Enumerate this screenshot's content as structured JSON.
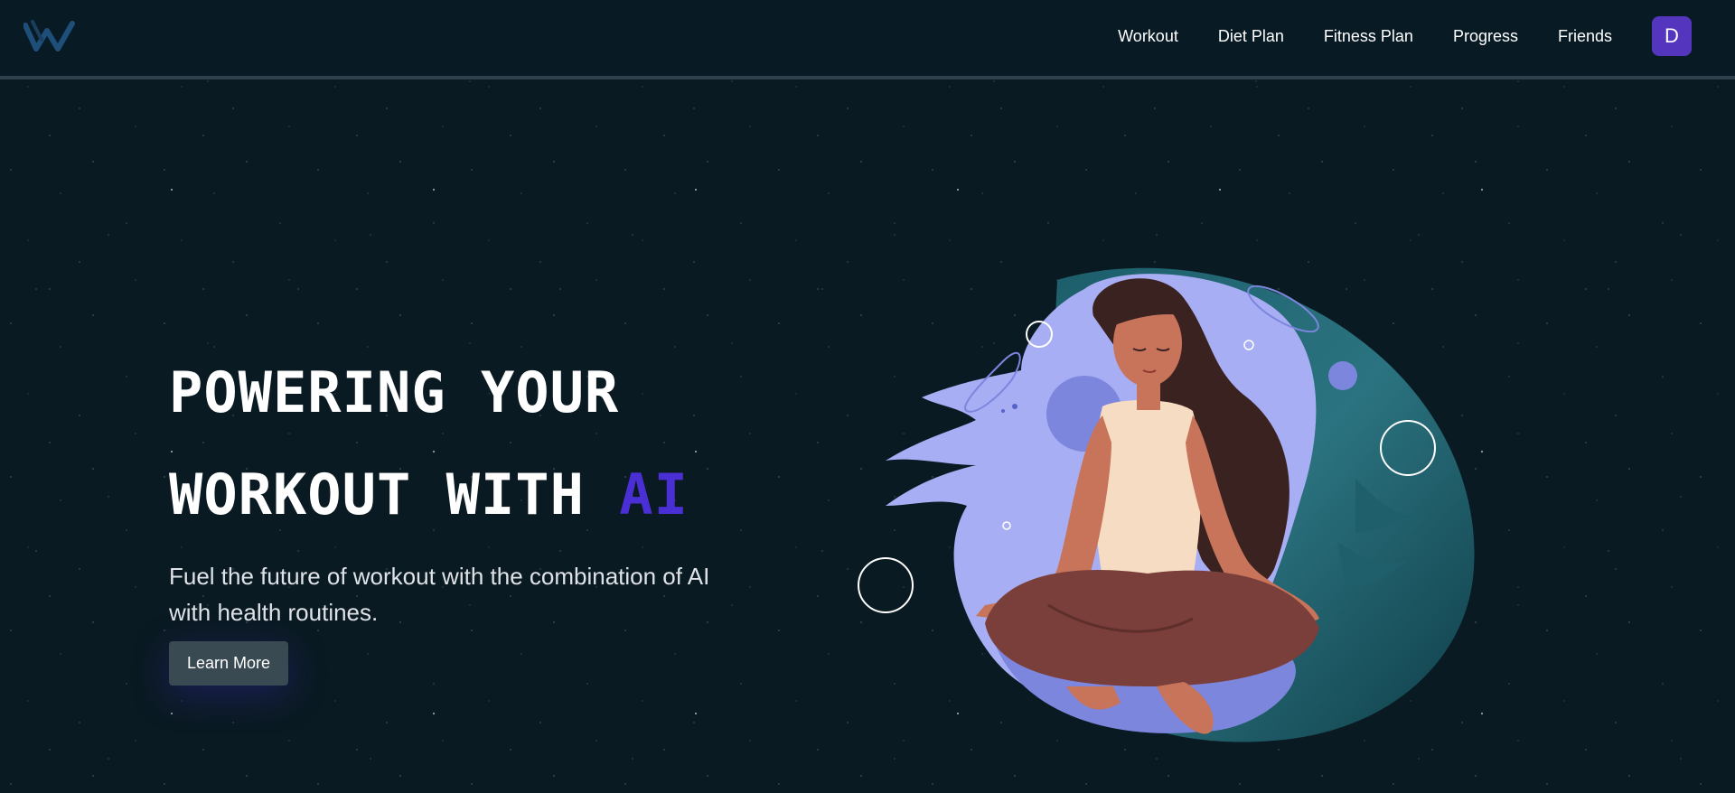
{
  "nav": {
    "links": [
      "Workout",
      "Diet Plan",
      "Fitness Plan",
      "Progress",
      "Friends"
    ],
    "avatar_initial": "D"
  },
  "hero": {
    "headline_line1": "POWERING YOUR",
    "headline_line2_prefix": "WORKOUT WITH ",
    "headline_accent": "AI",
    "subtext": "Fuel the future of workout with the combination of AI with health routines.",
    "cta_label": "Learn More"
  },
  "colors": {
    "background": "#0a1a22",
    "header": "#081b24",
    "accent": "#4a2fd4",
    "avatar": "#5436be",
    "button": "#3a4a53"
  },
  "icons": {
    "logo": "w-logo-icon",
    "illustration": "meditating-woman-illustration"
  }
}
